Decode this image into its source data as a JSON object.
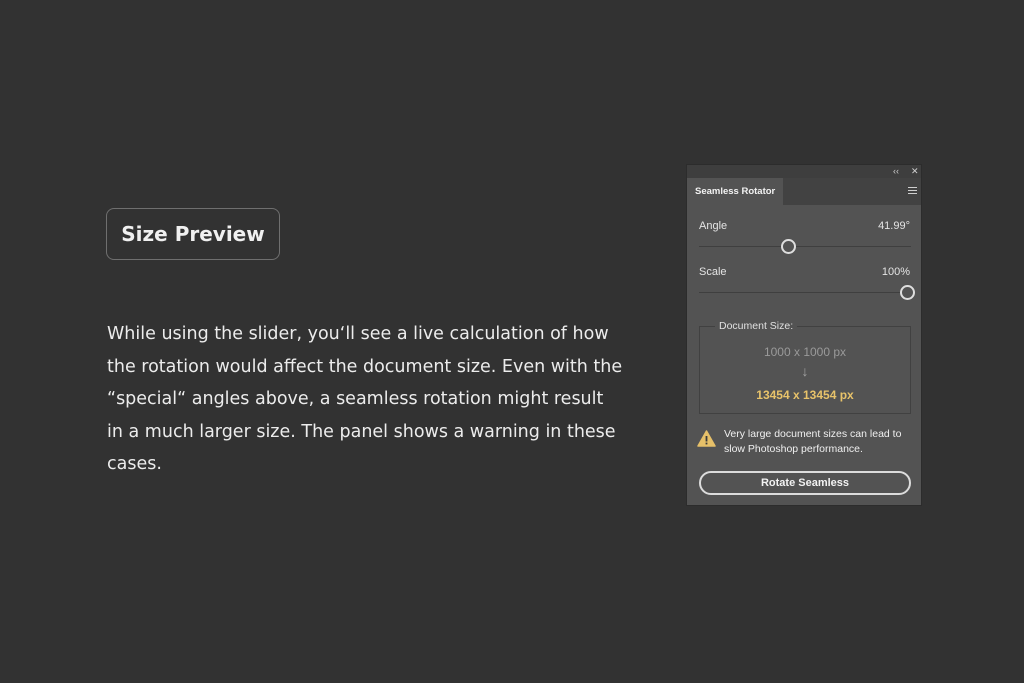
{
  "badge": {
    "label": "Size Preview"
  },
  "description": {
    "lines": [
      "While using the slider, you‘ll see a live calculation of how",
      "the rotation would affect the document size. Even with the",
      "“special“ angles above, a seamless rotation might result",
      "in a much larger size. The panel shows a warning in these",
      "cases."
    ]
  },
  "panel": {
    "titlebar": {
      "collapse_icon": "double-chevron-left-icon",
      "close_icon": "close-icon"
    },
    "tab_label": "Seamless Rotator",
    "angle": {
      "label": "Angle",
      "value": "41.99°",
      "slider_fraction": 0.42
    },
    "scale": {
      "label": "Scale",
      "value": "100%",
      "slider_fraction": 1.0
    },
    "document_size": {
      "title": "Document Size:",
      "original": "1000 x 1000 px",
      "arrow_icon": "arrow-down-icon",
      "result": "13454 x 13454 px"
    },
    "warning": {
      "icon": "warning-triangle-icon",
      "text": "Very large document sizes can lead to slow Photoshop performance."
    },
    "button_label": "Rotate Seamless",
    "colors": {
      "accent": "#e8c36a",
      "warning_icon": "#e6c069",
      "panel_bg": "#535353"
    }
  }
}
